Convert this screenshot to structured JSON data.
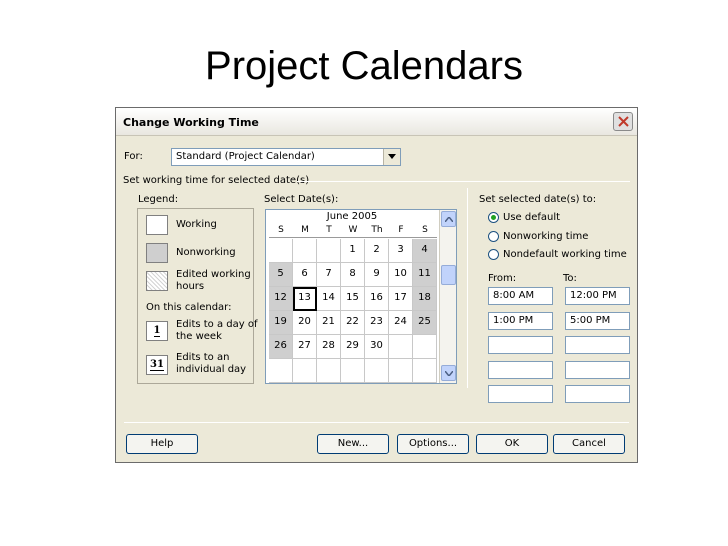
{
  "slide": {
    "title": "Project Calendars"
  },
  "dialog": {
    "title": "Change Working Time",
    "for_label": "For:",
    "calendar_selected": "Standard (Project Calendar)",
    "set_working_time_label": "Set working time for selected date(s)"
  },
  "legend": {
    "title": "Legend:",
    "working": "Working",
    "nonworking": "Nonworking",
    "edited_line1": "Edited working",
    "edited_line2": "hours",
    "on_this_calendar": "On this calendar:",
    "day_of_week_swatch": "1",
    "day_of_week_line1": "Edits to a day of",
    "day_of_week_line2": "the week",
    "individual_swatch": "31",
    "individual_line1": "Edits to an",
    "individual_line2": "individual day"
  },
  "calendar": {
    "select_label": "Select Date(s):",
    "month": "June 2005",
    "day_headers": [
      "S",
      "M",
      "T",
      "W",
      "Th",
      "F",
      "S"
    ],
    "weeks": [
      [
        "",
        "",
        "",
        "1",
        "2",
        "3",
        "4"
      ],
      [
        "5",
        "6",
        "7",
        "8",
        "9",
        "10",
        "11"
      ],
      [
        "12",
        "13",
        "14",
        "15",
        "16",
        "17",
        "18"
      ],
      [
        "19",
        "20",
        "21",
        "22",
        "23",
        "24",
        "25"
      ],
      [
        "26",
        "27",
        "28",
        "29",
        "30",
        "",
        ""
      ],
      [
        "",
        "",
        "",
        "",
        "",
        "",
        ""
      ]
    ],
    "selected_day": "13"
  },
  "set_dates": {
    "title": "Set selected date(s) to:",
    "options": [
      "Use default",
      "Nonworking time",
      "Nondefault working time"
    ],
    "selected_option": "Use default",
    "from_label": "From:",
    "to_label": "To:",
    "time_rows": [
      {
        "from": "8:00 AM",
        "to": "12:00 PM"
      },
      {
        "from": "1:00 PM",
        "to": "5:00 PM"
      },
      {
        "from": "",
        "to": ""
      },
      {
        "from": "",
        "to": ""
      },
      {
        "from": "",
        "to": ""
      }
    ]
  },
  "buttons": {
    "help": "Help",
    "new": "New...",
    "options": "Options...",
    "ok": "OK",
    "cancel": "Cancel"
  },
  "colors": {
    "dialog_bg": "#ece9d8",
    "nonworking": "#cfcfcf",
    "close_x": "#c0392b",
    "radio_dot": "#21a121"
  }
}
